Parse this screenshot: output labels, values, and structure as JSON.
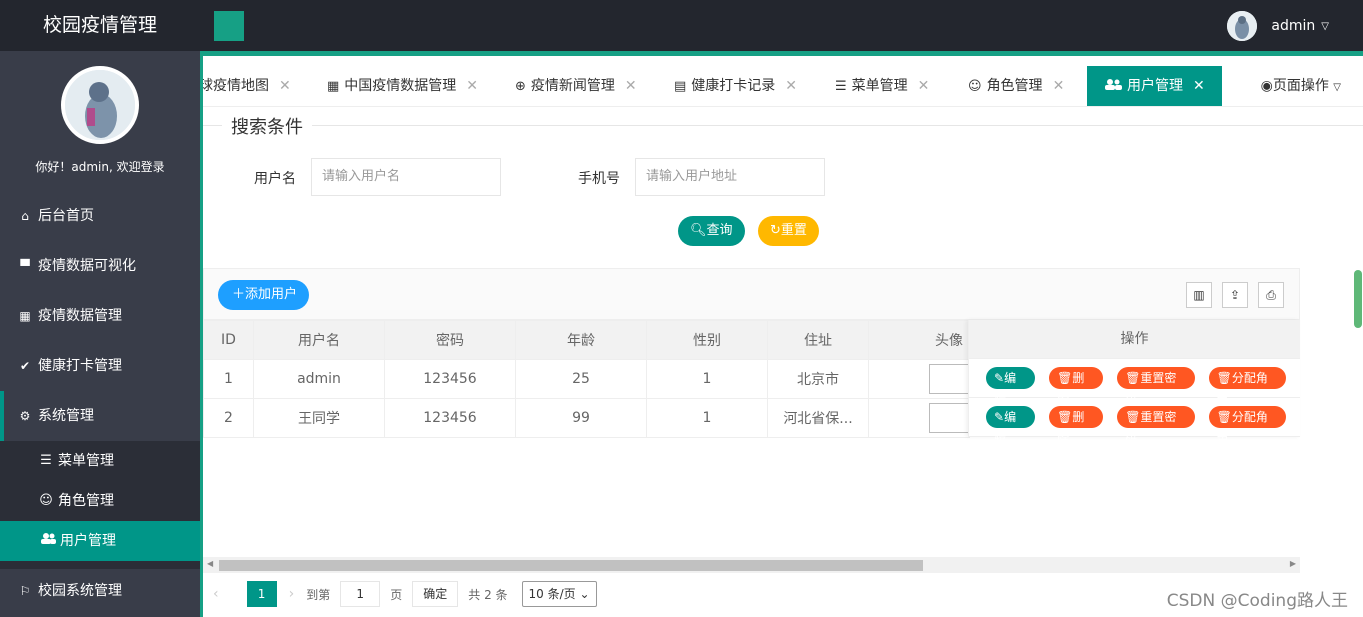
{
  "header": {
    "title": "校园疫情管理",
    "username": "admin"
  },
  "sidebar": {
    "greeting": "你好！admin, 欢迎登录",
    "items": [
      {
        "label": "后台首页",
        "icon": "⌂"
      },
      {
        "label": "疫情数据可视化",
        "icon": "▀"
      },
      {
        "label": "疫情数据管理",
        "icon": "▦"
      },
      {
        "label": "健康打卡管理",
        "icon": "✔"
      },
      {
        "label": "系统管理",
        "icon": "⚙"
      }
    ],
    "subitems": [
      {
        "label": "菜单管理",
        "icon": "☰"
      },
      {
        "label": "角色管理",
        "icon": "☺"
      },
      {
        "label": "用户管理",
        "icon": "👥"
      }
    ],
    "last_item": {
      "label": "校园系统管理",
      "icon": "⚐"
    }
  },
  "tabs": [
    {
      "label": "球疫情地图",
      "icon": ""
    },
    {
      "label": "中国疫情数据管理",
      "icon": "▦"
    },
    {
      "label": "疫情新闻管理",
      "icon": "⊕"
    },
    {
      "label": "健康打卡记录",
      "icon": "▤"
    },
    {
      "label": "菜单管理",
      "icon": "☰"
    },
    {
      "label": "角色管理",
      "icon": "☺"
    },
    {
      "label": "用户管理",
      "icon": "👥"
    }
  ],
  "page_ops": "页面操作",
  "search": {
    "legend": "搜索条件",
    "username_label": "用户名",
    "username_placeholder": "请输入用户名",
    "phone_label": "手机号",
    "phone_placeholder": "请输入用户地址",
    "query": "查询",
    "reset": "重置"
  },
  "toolbar": {
    "add": "添加用户"
  },
  "table": {
    "headers": [
      "ID",
      "用户名",
      "密码",
      "年龄",
      "性别",
      "住址",
      "头像"
    ],
    "ops_header": "操作",
    "rows": [
      [
        "1",
        "admin",
        "123456",
        "25",
        "1",
        "北京市"
      ],
      [
        "2",
        "王同学",
        "123456",
        "99",
        "1",
        "河北省保..."
      ]
    ],
    "ops": [
      "编辑",
      "删除",
      "重置密码",
      "分配角色"
    ]
  },
  "pager": {
    "current": "1",
    "goto": "到第",
    "page_input": "1",
    "page_unit": "页",
    "confirm": "确定",
    "total": "共 2 条",
    "size": "10 条/页"
  },
  "watermark": "CSDN @Coding路人王",
  "colors": {
    "primary": "#009688",
    "header": "#23262e",
    "sidebar": "#393d49",
    "danger": "#ff5722",
    "warn": "#ffb800",
    "blue": "#1e9fff"
  }
}
